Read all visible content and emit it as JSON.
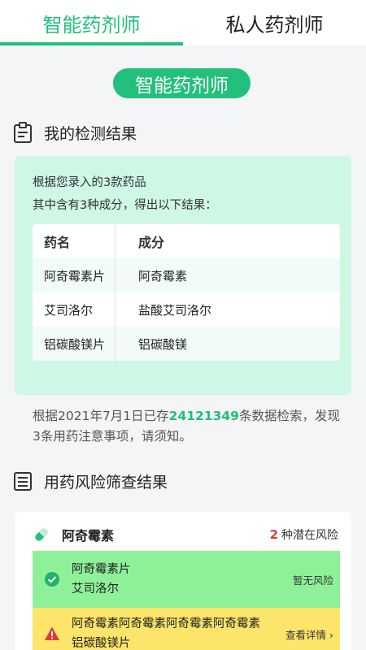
{
  "tabs": [
    {
      "label": "智能药剂师",
      "active": true
    },
    {
      "label": "私人药剂师",
      "active": false
    }
  ],
  "pill_title": "智能药剂师",
  "detection": {
    "heading": "我的检测结果",
    "line1": "根据您录入的3款药品",
    "line2": "其中含有3种成分，得出以下结果：",
    "table": {
      "headers": [
        "药名",
        "成分"
      ],
      "rows": [
        [
          "阿奇霉素片",
          "阿奇霉素"
        ],
        [
          "艾司洛尔",
          "盐酸艾司洛尔"
        ],
        [
          "铝碳酸镁片",
          "铝碳酸镁"
        ]
      ]
    }
  },
  "stats": {
    "prefix": "根据2021年7月1日已存",
    "count": "24121349",
    "suffix": "条数据检索，发现3条用药注意事项，请须知。"
  },
  "risk": {
    "heading": "用药风险筛查结果",
    "drug": "阿奇霉素",
    "risk_count": "2",
    "risk_label": "种潜在风险",
    "items": [
      {
        "names": [
          "阿奇霉素片",
          "艾司洛尔"
        ],
        "status": "暂无风险",
        "type": "safe"
      },
      {
        "names": [
          "阿奇霉素阿奇霉素阿奇霉素阿奇霉素",
          "铝碳酸镁片"
        ],
        "status": "查看详情 ›",
        "type": "warn"
      }
    ]
  },
  "colors": {
    "accent": "#22c07c",
    "safe": "#8ef19a",
    "warn": "#fce56a",
    "danger": "#e53935"
  }
}
